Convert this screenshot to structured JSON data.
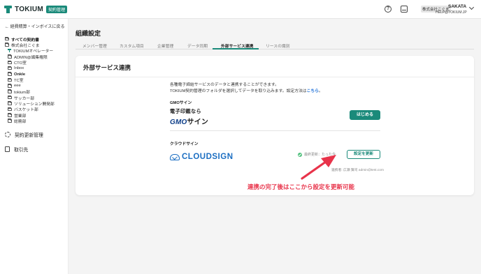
{
  "header": {
    "logo_text": "TOKIUM",
    "logo_badge": "契約管理",
    "help_icon": "help-circle-icon",
    "inbox_icon": "inbox-icon",
    "company_name": "株式会社こぐま",
    "user_name": "SAKATA",
    "user_email": "HELP@TOKIUM.JP"
  },
  "sidebar": {
    "back_link": "← 経費精算・インボイスに戻る",
    "tree": [
      {
        "label": "すべての契約書",
        "icon": "folder-icon",
        "bold": true,
        "indent": false
      },
      {
        "label": "株式会社こぐま",
        "icon": "folder-icon",
        "bold": false,
        "indent": false
      },
      {
        "label": "TOKIUMオペレーター",
        "icon": "tokium-icon",
        "bold": false,
        "indent": true
      },
      {
        "label": "ADMIN@編集権限",
        "icon": "folder-icon",
        "bold": false,
        "indent": true
      },
      {
        "label": "CTO室",
        "icon": "folder-icon",
        "bold": false,
        "indent": true
      },
      {
        "label": "Inbox",
        "icon": "folder-icon",
        "bold": false,
        "indent": true
      },
      {
        "label": "Onkle",
        "icon": "folder-icon",
        "bold": true,
        "indent": true
      },
      {
        "label": "TC室",
        "icon": "folder-icon",
        "bold": false,
        "indent": true
      },
      {
        "label": "eee",
        "icon": "folder-icon",
        "bold": false,
        "indent": true
      },
      {
        "label": "tokium部",
        "icon": "folder-icon",
        "bold": false,
        "indent": true
      },
      {
        "label": "サッカー部",
        "icon": "folder-icon",
        "bold": false,
        "indent": true
      },
      {
        "label": "ソリューション開発部",
        "icon": "folder-icon",
        "bold": false,
        "indent": true
      },
      {
        "label": "バスケット部",
        "icon": "folder-icon",
        "bold": false,
        "indent": true
      },
      {
        "label": "営業部",
        "icon": "folder-icon",
        "bold": false,
        "indent": true
      },
      {
        "label": "総務部",
        "icon": "folder-icon",
        "bold": false,
        "indent": true
      }
    ],
    "nav_renewal": "契約更新管理",
    "nav_partners": "取引先"
  },
  "main": {
    "page_title": "組織設定",
    "tabs": [
      {
        "label": "メンバー管理",
        "active": false
      },
      {
        "label": "カスタム項目",
        "active": false
      },
      {
        "label": "企業管理",
        "active": false
      },
      {
        "label": "データ同期",
        "active": false
      },
      {
        "label": "外部サービス連携",
        "active": true
      },
      {
        "label": "リースの識別",
        "active": false
      }
    ],
    "card": {
      "title": "外部サービス連携",
      "intro_line1": "各種電子締結サービスのデータと連携することができます。",
      "intro_line2": "TOKIUM契約管理のフォルダを選択してデータを取り込みます。設定方法は",
      "intro_link": "こちら",
      "intro_end": "。",
      "gmo": {
        "label": "GMOサイン",
        "logo_small": "電子印鑑なら",
        "logo_big_a": "GMO",
        "logo_big_b": "サイン",
        "button": "はじめる"
      },
      "cloudsign": {
        "label": "クラウドサイン",
        "logo_text": "CLOUDSIGN",
        "sync_status": "最終更新：たった今",
        "button": "設定を更新",
        "connector": "連携者: 広瀬 賢司 admin@test.com"
      }
    },
    "annotation": "連携の完了後はここから設定を更新可能",
    "annotation_color": "#e8334a"
  }
}
